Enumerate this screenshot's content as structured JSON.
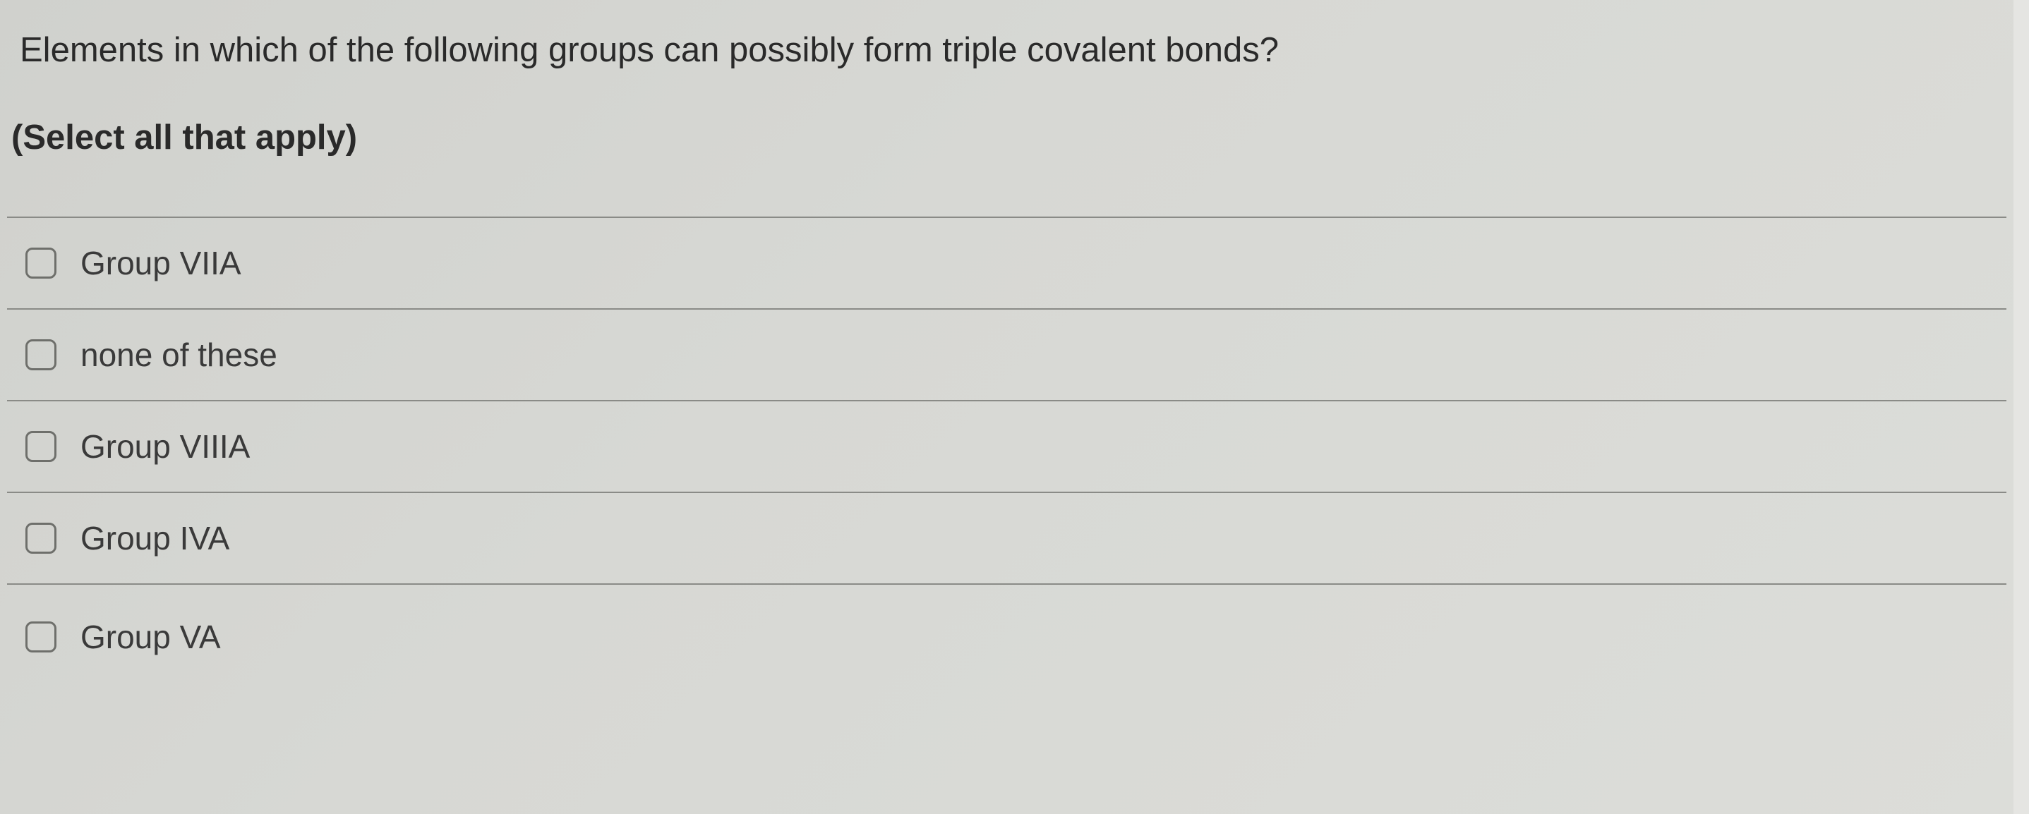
{
  "question": {
    "prompt": "Elements in which of the following groups can possibly form triple covalent bonds?",
    "instruction": "(Select all that apply)"
  },
  "options": [
    {
      "label": "Group VIIA",
      "checked": false
    },
    {
      "label": "none of these",
      "checked": false
    },
    {
      "label": "Group VIIIA",
      "checked": false
    },
    {
      "label": "Group IVA",
      "checked": false
    },
    {
      "label": "Group VA",
      "checked": false
    }
  ]
}
